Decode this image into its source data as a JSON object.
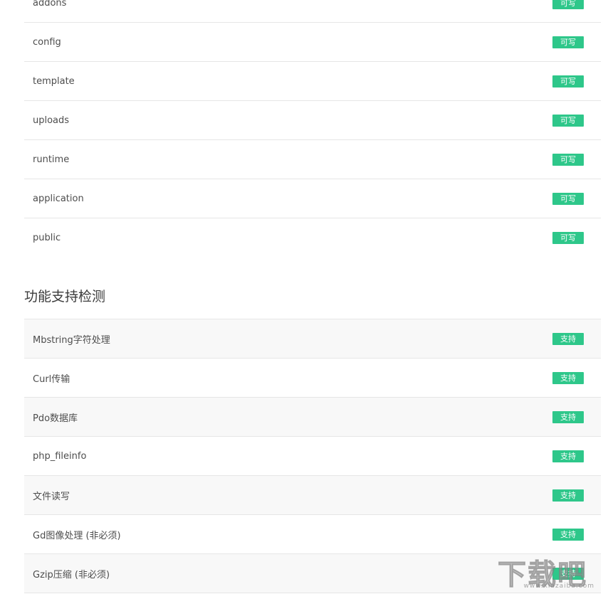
{
  "directories": [
    {
      "name": "addons",
      "status": "可写"
    },
    {
      "name": "config",
      "status": "可写"
    },
    {
      "name": "template",
      "status": "可写"
    },
    {
      "name": "uploads",
      "status": "可写"
    },
    {
      "name": "runtime",
      "status": "可写"
    },
    {
      "name": "application",
      "status": "可写"
    },
    {
      "name": "public",
      "status": "可写"
    }
  ],
  "features_section": {
    "title": "功能支持检测",
    "items": [
      {
        "name": "Mbstring字符处理",
        "status": "支持"
      },
      {
        "name": "Curl传输",
        "status": "支持"
      },
      {
        "name": "Pdo数据库",
        "status": "支持"
      },
      {
        "name": "php_fileinfo",
        "status": "支持"
      },
      {
        "name": "文件读写",
        "status": "支持"
      },
      {
        "name": "Gd图像处理 (非必须)",
        "status": "支持"
      },
      {
        "name": "Gzip压缩 (非必须)",
        "status": "支持"
      }
    ]
  },
  "watermark": {
    "logo": "下载吧",
    "site": "www.xiazaiba.com"
  },
  "colors": {
    "badge": "#2ec78a",
    "stripe": "#f8f8f8",
    "border": "#e6e6e6"
  }
}
